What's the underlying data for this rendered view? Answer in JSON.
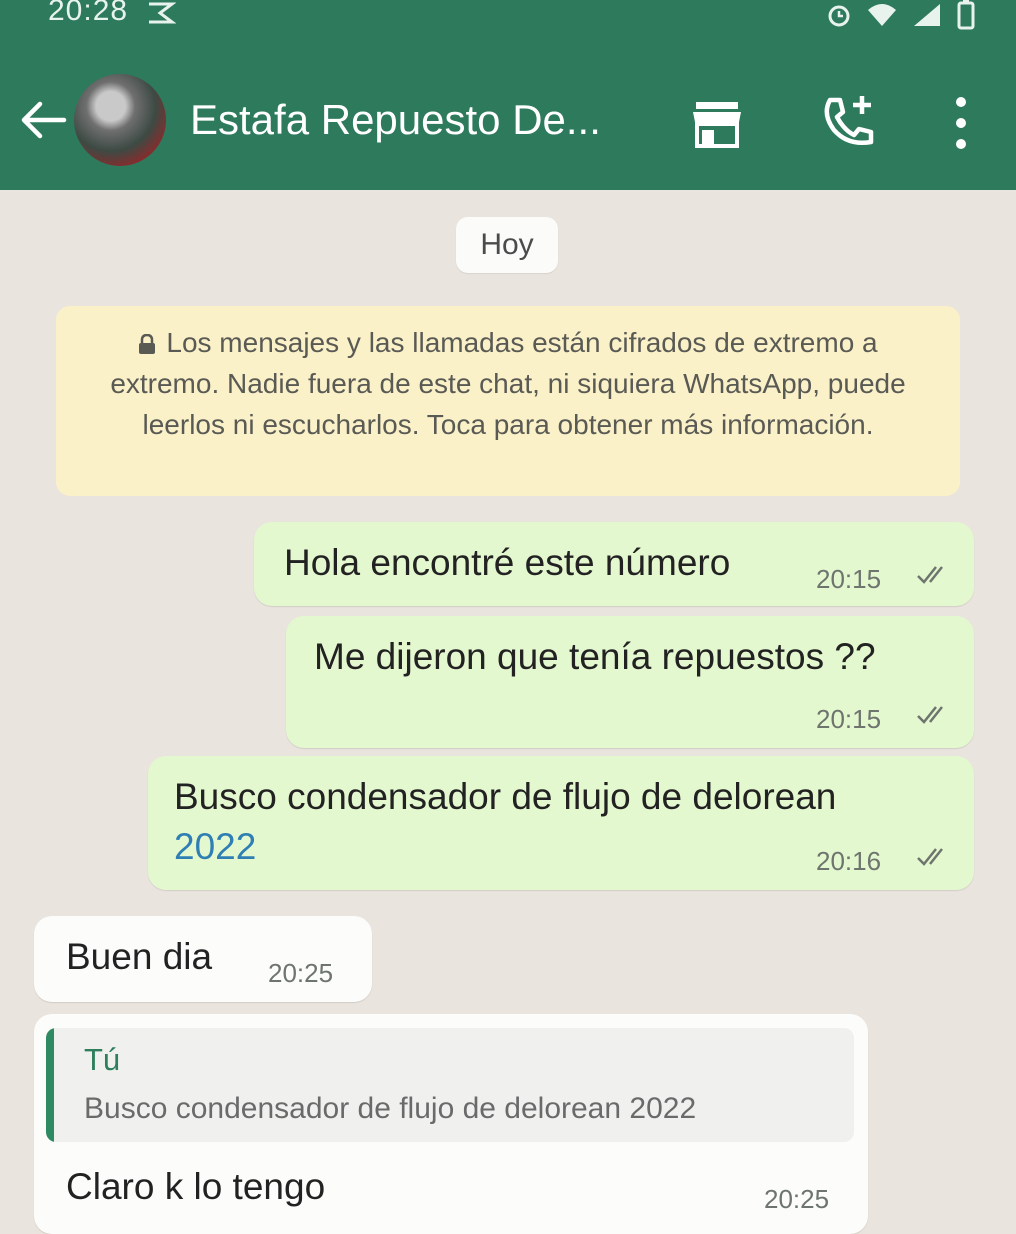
{
  "status_bar": {
    "time": "20:28",
    "left_icon": "notification-icon",
    "right_icons": [
      "alarm-icon",
      "wifi-icon",
      "signal-icon",
      "battery-icon"
    ]
  },
  "header": {
    "contact_name": "Estafa Repuesto De...",
    "icons": [
      "back-arrow-icon",
      "contact-avatar",
      "store-icon",
      "add-call-icon",
      "more-vertical-icon"
    ]
  },
  "chat": {
    "day_label": "Hoy",
    "encryption_notice": "Los mensajes y las llamadas están cifrados de extremo a extremo. Nadie fuera de este chat, ni siquiera WhatsApp, puede leerlos ni escucharlos. Toca para obtener más información.",
    "encryption_icon": "lock-icon",
    "messages": [
      {
        "direction": "outgoing",
        "text": "Hola encontré este número",
        "time": "20:15",
        "status": "read"
      },
      {
        "direction": "outgoing",
        "text": "Me dijeron que tenía repuestos ??",
        "time": "20:15",
        "status": "read"
      },
      {
        "direction": "outgoing",
        "text": "Busco condensador de flujo de delorean",
        "text_link": "2022",
        "time": "20:16",
        "status": "read"
      },
      {
        "direction": "incoming",
        "text": "Buen dia",
        "time": "20:25"
      },
      {
        "direction": "incoming",
        "quote": {
          "author": "Tú",
          "text": "Busco condensador de flujo de delorean 2022"
        },
        "text": "Claro k lo tengo",
        "time": "20:25"
      }
    ]
  },
  "colors": {
    "header": "#2e7a5d",
    "chat_background": "#e9e4dd",
    "outgoing_bubble": "#e4f8cf",
    "incoming_bubble": "#fcfcfb",
    "notice_background": "#fbf1c9",
    "quote_accent": "#2e8a63",
    "link": "#2f7fb4"
  }
}
